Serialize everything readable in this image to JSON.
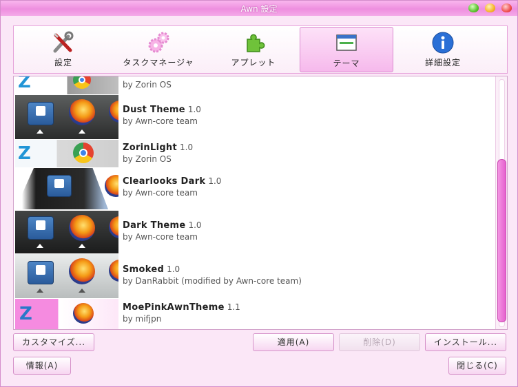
{
  "window": {
    "title": "Awn 設定"
  },
  "tabs": [
    {
      "label": "設定",
      "icon": "wrench-screwdriver-icon"
    },
    {
      "label": "タスクマネージャ",
      "icon": "gears-icon"
    },
    {
      "label": "アプレット",
      "icon": "puzzle-piece-icon"
    },
    {
      "label": "テーマ",
      "icon": "window-theme-icon",
      "active": true
    },
    {
      "label": "詳細設定",
      "icon": "info-icon"
    }
  ],
  "themes": [
    {
      "name": "",
      "version": "",
      "author": "by Zorin OS"
    },
    {
      "name": "Dust Theme",
      "version": "1.0",
      "author": "by Awn-core team"
    },
    {
      "name": "ZorinLight",
      "version": "1.0",
      "author": "by Zorin OS"
    },
    {
      "name": "Clearlooks Dark",
      "version": "1.0",
      "author": "by Awn-core team"
    },
    {
      "name": "Dark Theme",
      "version": "1.0",
      "author": "by Awn-core team"
    },
    {
      "name": "Smoked",
      "version": "1.0",
      "author": "by DanRabbit (modified by Awn-core team)"
    },
    {
      "name": "MoePinkAwnTheme",
      "version": "1.1",
      "author": "by mifjpn"
    }
  ],
  "buttons": {
    "customize": "カスタマイズ...",
    "apply": "適用(A)",
    "delete": "削除(D)",
    "install": "インストール...",
    "about": "情報(A)",
    "close": "閉じる(C)"
  },
  "colors": {
    "accent": "#ee8fdf",
    "titlebar": "#f4a9e8"
  }
}
